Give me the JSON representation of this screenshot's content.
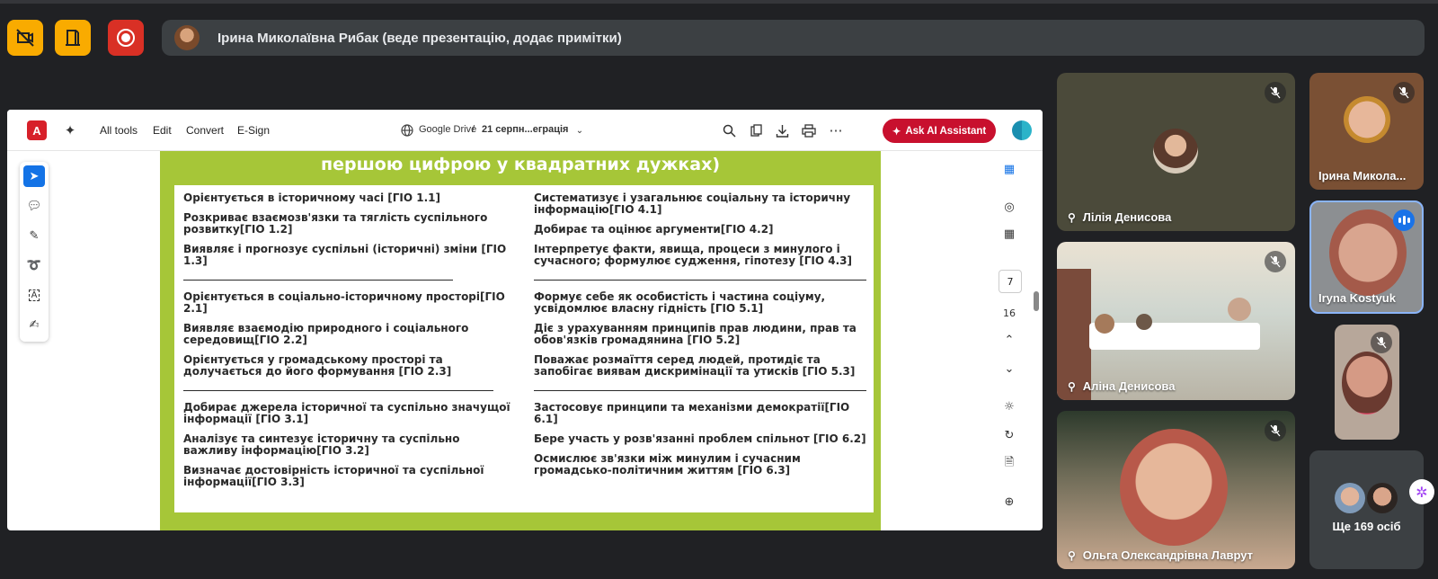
{
  "meet": {
    "presenter_text": "Ірина Миколаївна Рибак (веде презентацію, додає примітки)",
    "controls": [
      {
        "icon": "camera-off-icon"
      },
      {
        "icon": "door-exit-icon"
      },
      {
        "icon": "record-icon"
      }
    ],
    "colors": {
      "yellow": "#f9ab00",
      "red": "#d93025",
      "bg": "#202124",
      "tile": "#3c4043"
    }
  },
  "acrobat": {
    "menu": [
      "All tools",
      "Edit",
      "Convert",
      "E-Sign"
    ],
    "breadcrumb_root": "Google Drive",
    "breadcrumb_sep": "/",
    "doc_name": "21 серпн...еграція",
    "ask_ai": "Ask AI Assistant",
    "page_current": "7",
    "page_total": "16",
    "accent": "#c8102e"
  },
  "slide": {
    "heading_line": "першою цифрою у квадратних дужках)",
    "left_groups": [
      [
        "Орієнтується в історичному часі [ГІО 1.1]",
        "Розкриває взаємозв'язки та тяглість суспільного розвитку[ГІО 1.2]",
        "Виявляє і прогнозує суспільні (історичні) зміни [ГІО 1.3]"
      ],
      [
        "Орієнтується в соціально-історичному просторі[ГІО 2.1]",
        "Виявляє взаємодію природного і соціального середовищ[ГІО 2.2]",
        "Орієнтується у громадському просторі та долучається до його формування [ГІО 2.3]"
      ],
      [
        "Добирає джерела історичної та суспільно значущої інформації [ГІО 3.1]",
        "Аналізує та синтезує історичну та суспільно важливу інформацію[ГІО 3.2]",
        "Визначає достовірність історичної та суспільної інформації[ГІО 3.3]"
      ]
    ],
    "right_groups": [
      [
        "Систематизує і узагальнює соціальну та історичну інформацію[ГІО 4.1]",
        "Добирає та оцінює аргументи[ГІО 4.2]",
        "Інтерпретує факти, явища, процеси з минулого і сучасного; формулює судження, гіпотезу [ГІО 4.3]"
      ],
      [
        "Формує себе як особистість і частина соціуму, усвідомлює власну гідність [ГІО 5.1]",
        "Діє з урахуванням принципів прав людини, прав та обов'язків громадянина [ГІО 5.2]",
        "Поважає розмаїття серед людей, протидіє та запобігає виявам дискримінації та утисків [ГІО 5.3]"
      ],
      [
        "Застосовує принципи та механізми демократії[ГІО 6.1]",
        "Бере участь у розв'язанні проблем спільнот [ГІО 6.2]",
        "Осмислює зв'язки між минулим і сучасним громадсько-політичним життям [ГІО 6.3]"
      ]
    ],
    "green": "#a6c638"
  },
  "participants": {
    "lilia": "Лілія Денисова",
    "alina": "Аліна Денисова",
    "olga": "Ольга Олександрівна Лаврут",
    "iryna": "Ірина Микола...",
    "kostyuk": "Iryna Kostyuk",
    "more": "Ще 169 осіб"
  }
}
